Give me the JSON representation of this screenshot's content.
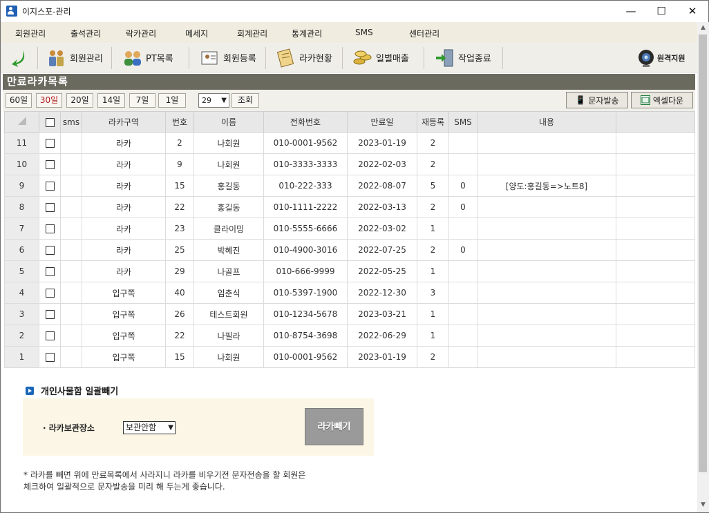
{
  "window": {
    "title": "이지스포-관리",
    "minimize": "—",
    "maximize": "☐",
    "close": "✕"
  },
  "menu": [
    "회원관리",
    "출석관리",
    "락카관리",
    "메세지",
    "회계관리",
    "통계관리",
    "SMS",
    "센터관리"
  ],
  "toolbar": {
    "buttons": [
      "회원관리",
      "PT목록",
      "회원등록",
      "라카현황",
      "일별매출",
      "작업종료"
    ],
    "remote": "원격지원"
  },
  "panel_title": "만료라카목록",
  "filters": {
    "days": [
      "60일",
      "30일",
      "20일",
      "14일",
      "7일",
      "1일"
    ],
    "active_index": 1,
    "select_value": "29",
    "search_label": "조회",
    "sms_button": "문자발송",
    "excel_button": "엑셀다운"
  },
  "table": {
    "headers": [
      "sms",
      "라카구역",
      "번호",
      "이름",
      "전화번호",
      "만료일",
      "재등록",
      "SMS",
      "내용"
    ],
    "rows": [
      {
        "n": "11",
        "zone": "라카",
        "no": "2",
        "name": "나회원",
        "phone": "010-0001-9562",
        "expire": "2023-01-19",
        "re": "2",
        "sms": "",
        "memo": ""
      },
      {
        "n": "10",
        "zone": "라카",
        "no": "9",
        "name": "나회원",
        "phone": "010-3333-3333",
        "expire": "2022-02-03",
        "re": "2",
        "sms": "",
        "memo": ""
      },
      {
        "n": "9",
        "zone": "라카",
        "no": "15",
        "name": "홍길동",
        "phone": "010-222-333",
        "expire": "2022-08-07",
        "re": "5",
        "sms": "0",
        "memo": "[양도:홍길동=>노트8]"
      },
      {
        "n": "8",
        "zone": "라카",
        "no": "22",
        "name": "홍길동",
        "phone": "010-1111-2222",
        "expire": "2022-03-13",
        "re": "2",
        "sms": "0",
        "memo": ""
      },
      {
        "n": "7",
        "zone": "라카",
        "no": "23",
        "name": "클라이밍",
        "phone": "010-5555-6666",
        "expire": "2022-03-02",
        "re": "1",
        "sms": "",
        "memo": ""
      },
      {
        "n": "6",
        "zone": "라카",
        "no": "25",
        "name": "박혜진",
        "phone": "010-4900-3016",
        "expire": "2022-07-25",
        "re": "2",
        "sms": "0",
        "memo": ""
      },
      {
        "n": "5",
        "zone": "라카",
        "no": "29",
        "name": "나골프",
        "phone": "010-666-9999",
        "expire": "2022-05-25",
        "re": "1",
        "sms": "",
        "memo": ""
      },
      {
        "n": "4",
        "zone": "입구쪽",
        "no": "40",
        "name": "임춘식",
        "phone": "010-5397-1900",
        "expire": "2022-12-30",
        "re": "3",
        "sms": "",
        "memo": ""
      },
      {
        "n": "3",
        "zone": "입구쪽",
        "no": "26",
        "name": "테스트회원",
        "phone": "010-1234-5678",
        "expire": "2023-03-21",
        "re": "1",
        "sms": "",
        "memo": ""
      },
      {
        "n": "2",
        "zone": "입구쪽",
        "no": "22",
        "name": "나필라",
        "phone": "010-8754-3698",
        "expire": "2022-06-29",
        "re": "1",
        "sms": "",
        "memo": ""
      },
      {
        "n": "1",
        "zone": "입구쪽",
        "no": "15",
        "name": "나회원",
        "phone": "010-0001-9562",
        "expire": "2023-01-19",
        "re": "2",
        "sms": "",
        "memo": ""
      }
    ]
  },
  "bulk": {
    "title": "개인사물함 일괄빼기",
    "storage_label": "· 라카보관장소",
    "storage_value": "보관안함",
    "action_button": "라카빼기",
    "note_line1": "* 라카를 빼면 위에 만료목록에서 사라지니 라카를 비우기전 문자전송을 할 회원은",
    "note_line2": "체크하여 일괄적으로 문자발송을 미리 해 두는게 좋습니다."
  },
  "colors": {
    "panel_title_bg": "#6b6a5f",
    "menu_bg": "#f0ecdf",
    "bulk_bg": "#fbf6e6",
    "active_filter": "#b11b1b"
  }
}
